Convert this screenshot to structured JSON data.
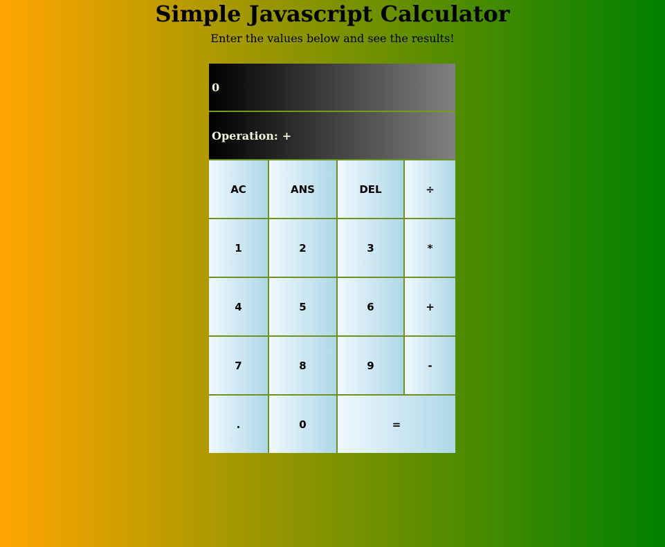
{
  "header": {
    "title": "Simple Javascript Calculator",
    "subtitle": "Enter the values below and see the results!"
  },
  "display": {
    "value": "0",
    "operation_label": "Operation:",
    "operation_value": "+"
  },
  "keys": {
    "ac": "AC",
    "ans": "ANS",
    "del": "DEL",
    "divide": "÷",
    "one": "1",
    "two": "2",
    "three": "3",
    "multiply": "*",
    "four": "4",
    "five": "5",
    "six": "6",
    "plus": "+",
    "seven": "7",
    "eight": "8",
    "nine": "9",
    "minus": "-",
    "dot": ".",
    "zero": "0",
    "equals": "="
  },
  "colors": {
    "background_start": "#ffa500",
    "background_end": "#008000",
    "display_start": "#000000",
    "display_end": "#808080",
    "display_text": "#f5f5dc",
    "key_start": "#f0f8ff",
    "key_end": "#add8e6"
  }
}
